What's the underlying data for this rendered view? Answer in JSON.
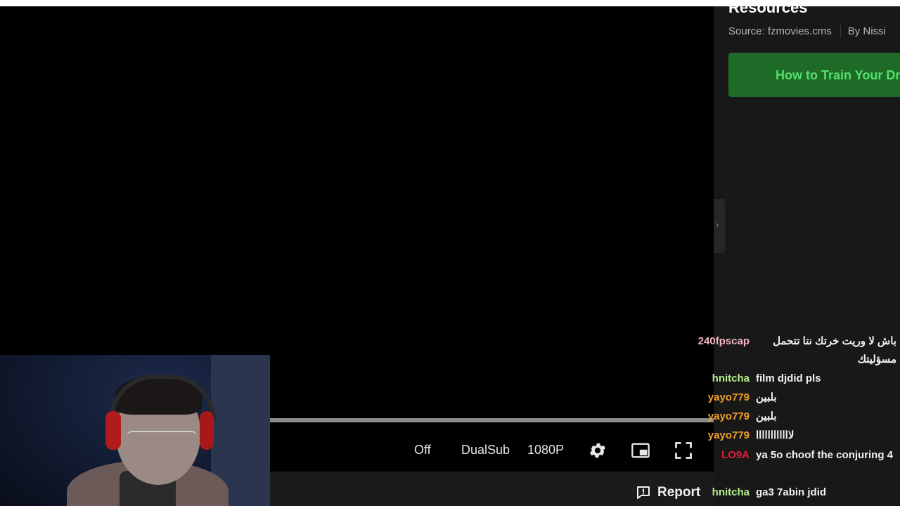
{
  "player": {
    "progress": 1.0,
    "controls": {
      "subtitle_off": "Off",
      "dualsub": "DualSub",
      "quality": "1080P"
    },
    "report_label": "Report"
  },
  "sidebar": {
    "title": "Resources",
    "source": "Source: fzmovies.cms",
    "author": "By Nissi",
    "watch_button": "How to Train Your Dr",
    "collapse_glyph": "›"
  },
  "chat": {
    "messages": [
      {
        "user": "240fpscap",
        "color": "#f5b6c4",
        "text": "باش لا وريت خرتك نتا تتحمل مسؤليتك"
      },
      {
        "user": "hnitcha",
        "color": "#b6f08c",
        "text": "film djdid pls"
      },
      {
        "user": "yayo779",
        "color": "#f0a02a",
        "text": "بلبين"
      },
      {
        "user": "yayo779",
        "color": "#f0a02a",
        "text": "بلبين"
      },
      {
        "user": "yayo779",
        "color": "#f0a02a",
        "text": "لاااااااااااا"
      },
      {
        "user": "LO9A",
        "color": "#e01e3c",
        "text": "ya 5o choof the conjuring 4"
      },
      {
        "user": "hnitcha",
        "color": "#b6f08c",
        "text": "ga3 7abin jdid"
      }
    ]
  }
}
